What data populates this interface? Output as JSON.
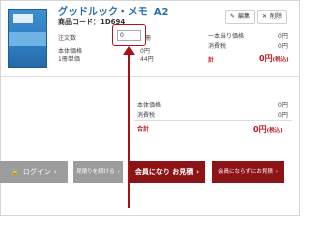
{
  "product": {
    "title": "グッドルック・メモ",
    "size": "A2",
    "code_label": "商品コード：",
    "code_value": "1D694",
    "quantity_label": "注文数",
    "quantity_value": "0",
    "quantity_unit": "冊",
    "base_price_label": "本体価格",
    "base_price_value": "0円",
    "unit_price_label": "1冊単価",
    "unit_price_value": "44円"
  },
  "actions": {
    "edit_label": "編集",
    "delete_label": "削除"
  },
  "item_summary": {
    "initial_fee_label": "一本当り価格",
    "initial_fee_value": "0円",
    "tax_label": "消費税",
    "tax_value": "0円",
    "total_label": "計",
    "total_value": "0円",
    "total_tax_note": "(税込)"
  },
  "order_summary": {
    "base_label": "本体価格",
    "base_value": "0円",
    "tax_label": "消費税",
    "tax_value": "0円",
    "total_label": "合計",
    "total_value": "0円",
    "total_tax_note": "(税込)"
  },
  "buttons": {
    "login": "ログイン",
    "continue": "見積りを続ける",
    "register_quote": "会員になり お見積",
    "guest_quote": "会員にならずにお見積"
  },
  "colors": {
    "accent_red": "#8c1416",
    "title_blue": "#2a6ea8",
    "gray_button": "#9c9c9c"
  },
  "icons": {
    "edit": "pencil-icon",
    "delete": "x-icon",
    "login": "lock-icon",
    "chevron": "chevron-right-icon"
  }
}
